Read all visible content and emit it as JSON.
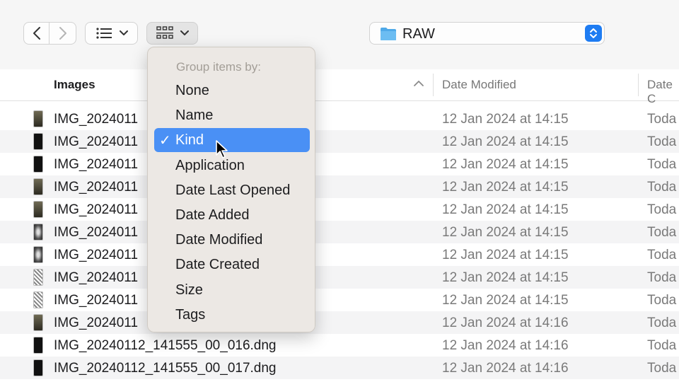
{
  "toolbar": {
    "path_label": "RAW"
  },
  "columns": {
    "name": "Images",
    "date_modified": "Date Modified",
    "date_created": "Date C"
  },
  "rows": [
    {
      "name": "IMG_2024011",
      "modified": "12 Jan 2024 at 14:15",
      "created": "Toda"
    },
    {
      "name": "IMG_2024011",
      "modified": "12 Jan 2024 at 14:15",
      "created": "Toda"
    },
    {
      "name": "IMG_2024011",
      "modified": "12 Jan 2024 at 14:15",
      "created": "Toda"
    },
    {
      "name": "IMG_2024011",
      "modified": "12 Jan 2024 at 14:15",
      "created": "Toda"
    },
    {
      "name": "IMG_2024011",
      "modified": "12 Jan 2024 at 14:15",
      "created": "Toda"
    },
    {
      "name": "IMG_2024011",
      "modified": "12 Jan 2024 at 14:15",
      "created": "Toda"
    },
    {
      "name": "IMG_2024011",
      "modified": "12 Jan 2024 at 14:15",
      "created": "Toda"
    },
    {
      "name": "IMG_2024011",
      "modified": "12 Jan 2024 at 14:15",
      "created": "Toda"
    },
    {
      "name": "IMG_2024011",
      "modified": "12 Jan 2024 at 14:15",
      "created": "Toda"
    },
    {
      "name": "IMG_2024011",
      "modified": "12 Jan 2024 at 14:16",
      "created": "Toda"
    },
    {
      "name": "IMG_20240112_141555_00_016.dng",
      "modified": "12 Jan 2024 at 14:16",
      "created": "Toda"
    },
    {
      "name": "IMG_20240112_141555_00_017.dng",
      "modified": "12 Jan 2024 at 14:16",
      "created": "Toda"
    }
  ],
  "menu": {
    "heading": "Group items by:",
    "check_mark": "✓",
    "items": [
      {
        "label": "None"
      },
      {
        "label": "Name"
      },
      {
        "label": "Kind",
        "selected": true
      },
      {
        "label": "Application"
      },
      {
        "label": "Date Last Opened"
      },
      {
        "label": "Date Added"
      },
      {
        "label": "Date Modified"
      },
      {
        "label": "Date Created"
      },
      {
        "label": "Size"
      },
      {
        "label": "Tags"
      }
    ]
  },
  "icons": {
    "back": "chevron-left-icon",
    "forward": "chevron-right-icon",
    "list_view": "list-view-icon",
    "group": "grid-group-icon",
    "folder": "folder-icon",
    "stepper": "up-down-chevron-icon",
    "cursor": "mouse-pointer-icon"
  },
  "colors": {
    "accent": "#4a90f5",
    "stepper": "#1e7cf2",
    "folder": "#4fa9e8",
    "menu_bg": "#ece8e3",
    "secondary_text": "#7a7a7a"
  }
}
